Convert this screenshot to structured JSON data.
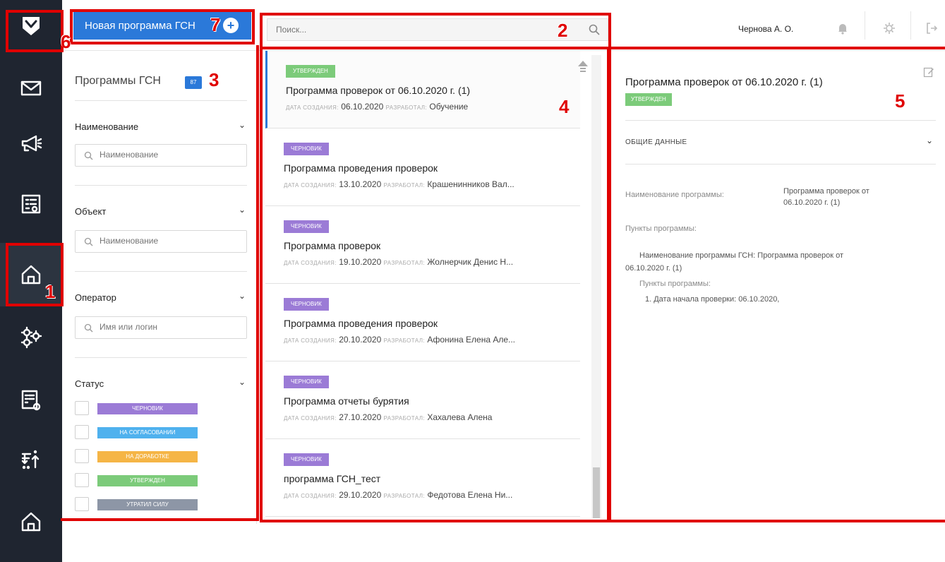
{
  "topbar": {
    "new_button_label": "Новая программа ГСН",
    "search_placeholder": "Поиск...",
    "user_name": "Чернова А. О."
  },
  "rail": {
    "icons": [
      "logo-shield-icon",
      "mail-icon",
      "megaphone-icon",
      "form-icon",
      "home-icon",
      "gears-icon",
      "document-search-icon",
      "sort-icon",
      "home-icon"
    ],
    "active_index": 4
  },
  "filters": {
    "title": "Программы ГСН",
    "count": "87",
    "sections": [
      {
        "label": "Наименование",
        "placeholder": "Наименование"
      },
      {
        "label": "Объект",
        "placeholder": "Наименование"
      },
      {
        "label": "Оператор",
        "placeholder": "Имя или логин"
      }
    ],
    "status_label": "Статус",
    "statuses": [
      {
        "label": "ЧЕРНОВИК",
        "color": "#9b7bd6"
      },
      {
        "label": "НА СОГЛАСОВАНИИ",
        "color": "#4fb1ee"
      },
      {
        "label": "НА ДОРАБОТКЕ",
        "color": "#f5b546"
      },
      {
        "label": "УТВЕРЖДЕН",
        "color": "#7ccb7a"
      },
      {
        "label": "УТРАТИЛ СИЛУ",
        "color": "#8d96a6"
      }
    ]
  },
  "list": {
    "created_label": "ДАТА СОЗДАНИЯ:",
    "author_label": "РАЗРАБОТАЛ:",
    "cards": [
      {
        "status": "УТВЕРЖДЕН",
        "status_color": "#7ccb7a",
        "title": "Программа проверок от 06.10.2020 г. (1)",
        "date": "06.10.2020",
        "author": "Обучение"
      },
      {
        "status": "ЧЕРНОВИК",
        "status_color": "#9b7bd6",
        "title": "Программа проведения проверок",
        "date": "13.10.2020",
        "author": "Крашенинников Вал..."
      },
      {
        "status": "ЧЕРНОВИК",
        "status_color": "#9b7bd6",
        "title": "Программа проверок",
        "date": "19.10.2020",
        "author": "Жолнерчик Денис Н..."
      },
      {
        "status": "ЧЕРНОВИК",
        "status_color": "#9b7bd6",
        "title": "Программа проведения проверок",
        "date": "20.10.2020",
        "author": "Афонина Елена Але..."
      },
      {
        "status": "ЧЕРНОВИК",
        "status_color": "#9b7bd6",
        "title": "Программа отчеты бурятия",
        "date": "27.10.2020",
        "author": "Хахалева Алена"
      },
      {
        "status": "ЧЕРНОВИК",
        "status_color": "#9b7bd6",
        "title": "программа ГСН_тест",
        "date": "29.10.2020",
        "author": "Федотова Елена Ни..."
      }
    ]
  },
  "detail": {
    "title": "Программа проверок от 06.10.2020 г. (1)",
    "status": "УТВЕРЖДЕН",
    "section": "ОБЩИЕ ДАННЫЕ",
    "name_label": "Наименование программы:",
    "name_value_1": "Программа проверок от",
    "name_value_2": "06.10.2020 г. (1)",
    "points_label": "Пункты программы:",
    "nested_line_1": "Наименование программы ГСН: Программа проверок от",
    "nested_line_2": "06.10.2020 г. (1)",
    "nested_points_label": "Пункты программы:",
    "nested_item": "1. Дата начала проверки: 06.10.2020,"
  },
  "annotations": [
    "1",
    "2",
    "3",
    "4",
    "5",
    "6",
    "7"
  ]
}
